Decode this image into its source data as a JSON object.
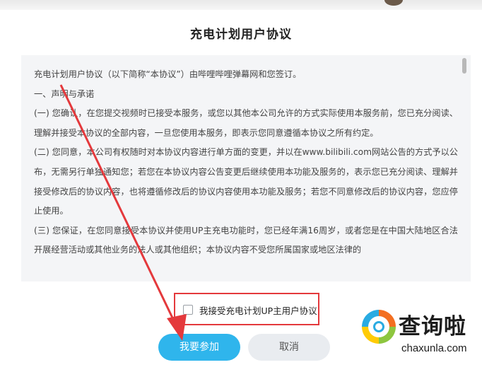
{
  "dialog": {
    "title": "充电计划用户协议",
    "agreement_paragraphs": [
      "充电计划用户协议（以下简称“本协议”）由哔哩哔哩弹幕网和您签订。",
      "一、声明与承诺",
      "(一) 您确认，在您提交视频时已接受本服务，或您以其他本公司允许的方式实际使用本服务前，您已充分阅读、理解并接受本协议的全部内容，一旦您使用本服务，即表示您同意遵循本协议之所有约定。",
      "(二) 您同意，本公司有权随时对本协议内容进行单方面的变更，并以在www.bilibili.com网站公告的方式予以公布，无需另行单独通知您；若您在本协议内容公告变更后继续使用本功能及服务的，表示您已充分阅读、理解并接受修改后的协议内容，也将遵循修改后的协议内容使用本功能及服务；若您不同意修改后的协议内容，您应停止使用。",
      "(三) 您保证，在您同意接受本协议并使用UP主充电功能时，您已经年满16周岁，或者您是在中国大陆地区合法开展经营活动或其他业务的法人或其他组织；本协议内容不受您所属国家或地区法律的"
    ],
    "agree_checkbox_label": "我接受充电计划UP主用户协议",
    "agree_checked": false,
    "join_button_label": "我要参加",
    "cancel_button_label": "取消"
  },
  "watermark": {
    "name_cn": "查询啦",
    "name_en": "chaxunla.com"
  },
  "colors": {
    "primary_button": "#2fb5ec",
    "cancel_button": "#e9ecf0",
    "highlight_box": "#e4393c",
    "arrow": "#e4393c",
    "text_area_bg": "#f4f5f7"
  }
}
